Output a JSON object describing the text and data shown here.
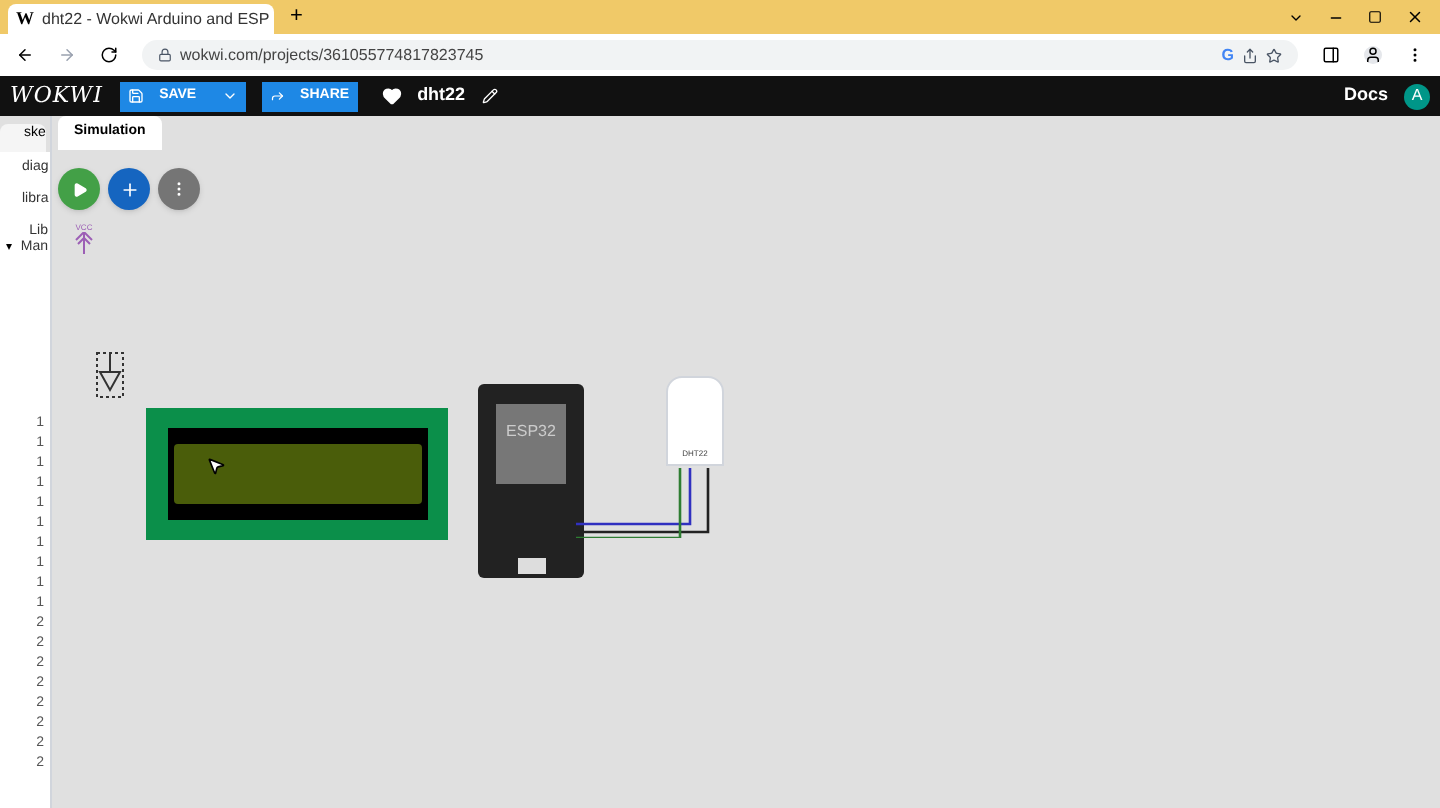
{
  "browser": {
    "favicon": "W",
    "google": "G",
    "tab_title": "dht22 - Wokwi Arduino and ESP",
    "new_tab": "+",
    "url": "wokwi.com/projects/361055774817823745"
  },
  "header": {
    "logo": "WOKWI",
    "save": "SAVE",
    "share": "SHARE",
    "project": "dht22",
    "docs": "Docs",
    "avatar": "A"
  },
  "editor_tabs": [
    {
      "label": "ske",
      "selected": false
    },
    {
      "label": "Simulation",
      "selected": true
    }
  ],
  "files": [
    "diag",
    "libra"
  ],
  "library_manager": [
    "Lib",
    "Man"
  ],
  "library_caret": "▾",
  "line_numbers": [
    "1",
    "1",
    "1",
    "1",
    "1",
    "1",
    "1",
    "1",
    "1",
    "1",
    "2",
    "2",
    "2",
    "2",
    "2",
    "2",
    "2",
    "2"
  ],
  "canvas": {
    "vcc_label": "VCC",
    "esp32_label": "ESP32",
    "dht_label": "DHT22"
  }
}
